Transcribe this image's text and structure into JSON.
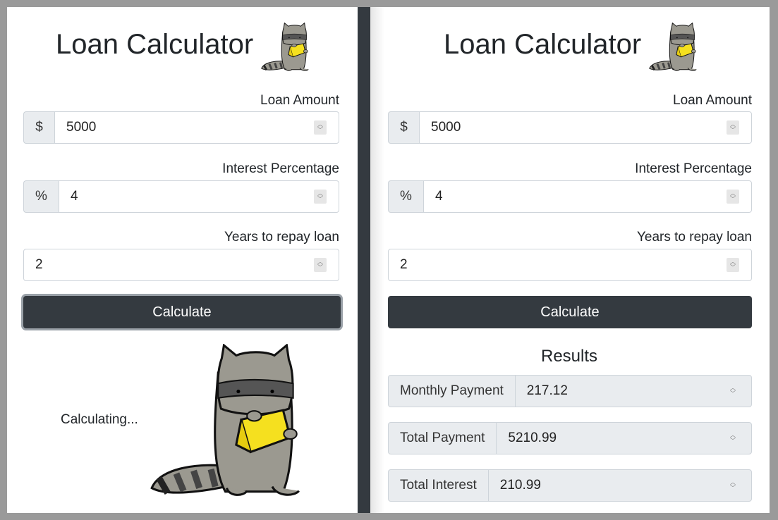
{
  "left": {
    "title": "Loan Calculator",
    "loan_amount": {
      "label": "Loan Amount",
      "prefix": "$",
      "value": "5000"
    },
    "interest": {
      "label": "Interest Percentage",
      "prefix": "%",
      "value": "4"
    },
    "years": {
      "label": "Years to repay loan",
      "value": "2"
    },
    "calculate_label": "Calculate",
    "status": "Calculating..."
  },
  "right": {
    "title": "Loan Calculator",
    "loan_amount": {
      "label": "Loan Amount",
      "prefix": "$",
      "value": "5000"
    },
    "interest": {
      "label": "Interest Percentage",
      "prefix": "%",
      "value": "4"
    },
    "years": {
      "label": "Years to repay loan",
      "value": "2"
    },
    "calculate_label": "Calculate",
    "results": {
      "title": "Results",
      "monthly_payment": {
        "label": "Monthly Payment",
        "value": "217.12"
      },
      "total_payment": {
        "label": "Total Payment",
        "value": "5210.99"
      },
      "total_interest": {
        "label": "Total Interest",
        "value": "210.99"
      }
    }
  },
  "colors": {
    "button": "#343a40",
    "addon": "#e9ecef",
    "mascot_yellow": "#f5e01f",
    "mascot_gray": "#9b9990"
  },
  "icons": [
    "raccoon-logo-icon",
    "raccoon-mascot-icon",
    "spinner-arrows-icon"
  ]
}
